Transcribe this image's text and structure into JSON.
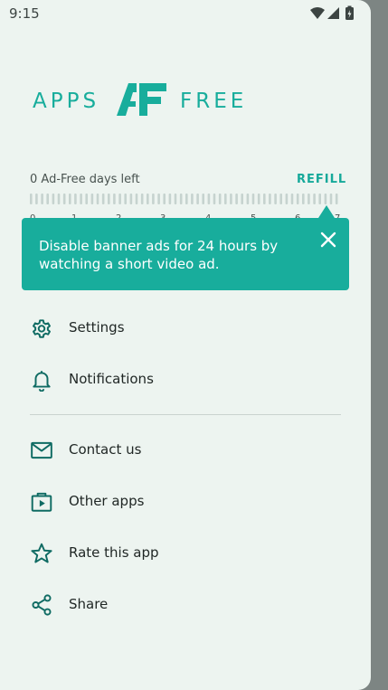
{
  "status_bar": {
    "time": "9:15"
  },
  "logo": {
    "left_text": "APPS",
    "right_text": "FREE",
    "mark_letters": "AF"
  },
  "ad_free": {
    "days_label": "0 Ad-Free days left",
    "refill_label": "REFILL",
    "tick_numbers": [
      "0",
      "1",
      "2",
      "3",
      "4",
      "5",
      "6",
      "7"
    ]
  },
  "tooltip": {
    "message": "Disable banner ads for 24 hours by watching a short video ad."
  },
  "menu": {
    "items": [
      {
        "label": "Settings",
        "icon": "gear-icon"
      },
      {
        "label": "Notifications",
        "icon": "bell-icon"
      },
      {
        "label": "Contact us",
        "icon": "mail-icon"
      },
      {
        "label": "Other apps",
        "icon": "play-store-icon"
      },
      {
        "label": "Rate this app",
        "icon": "star-icon"
      },
      {
        "label": "Share",
        "icon": "share-icon"
      }
    ]
  },
  "colors": {
    "accent": "#16a99a",
    "icon": "#0f6b63",
    "background": "#edf4f0"
  }
}
